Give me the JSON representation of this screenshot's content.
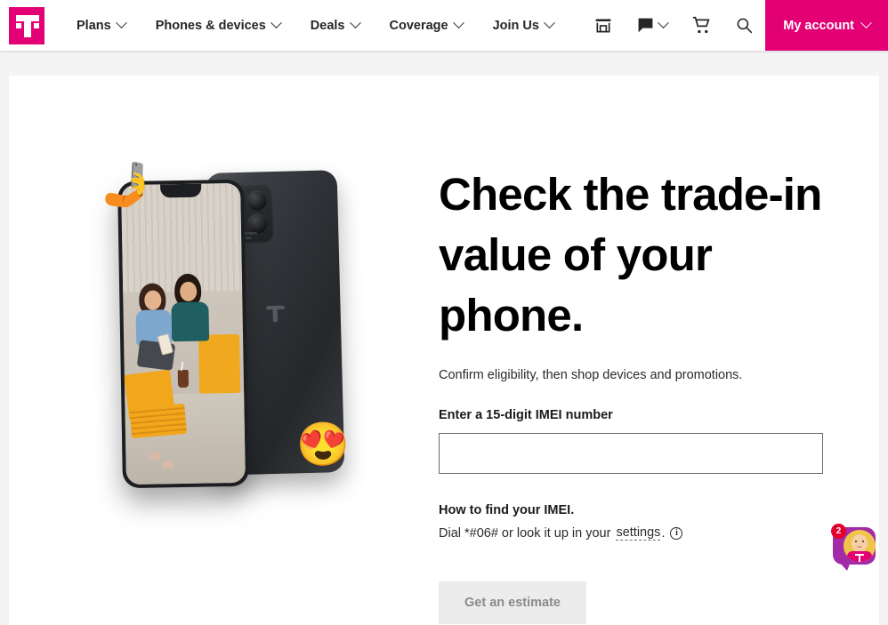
{
  "brand": {
    "name": "T-Mobile",
    "magenta": "#e20074",
    "logo_icon": "tmobile-logo"
  },
  "header": {
    "nav": [
      {
        "label": "Plans",
        "has_dropdown": true
      },
      {
        "label": "Phones & devices",
        "has_dropdown": true
      },
      {
        "label": "Deals",
        "has_dropdown": true
      },
      {
        "label": "Coverage",
        "has_dropdown": true
      },
      {
        "label": "Join Us",
        "has_dropdown": true
      }
    ],
    "icons": [
      {
        "name": "store-icon"
      },
      {
        "name": "chat-icon",
        "has_dropdown": true
      },
      {
        "name": "cart-icon"
      },
      {
        "name": "search-icon"
      }
    ],
    "account_button": {
      "label": "My account",
      "has_dropdown": true,
      "background": "#e20074",
      "text_color": "#ffffff"
    }
  },
  "hero": {
    "title": "Check the trade-in value of your phone.",
    "subtitle": "Confirm eligibility, then shop devices and promotions.",
    "image": {
      "alt": "Two phones, front screen showing a selfie of two women sitting in yellow chairs, back phone dark gray with quad camera",
      "emoji_selfie": "🤳",
      "emoji_heart_eyes": "😍"
    }
  },
  "form": {
    "imei_label": "Enter a 15-digit IMEI number",
    "imei_value": "",
    "imei_placeholder": "",
    "howto_title": "How to find your IMEI.",
    "howto_text_before": "Dial *#06# or look it up in your",
    "howto_link": "settings",
    "howto_text_after": ".",
    "info_icon_glyph": "i",
    "submit_label": "Get an estimate",
    "submit_disabled": true
  },
  "chat_widget": {
    "name": "chat-assistant",
    "badge_count": "2",
    "bubble_color": "#a32ba8",
    "badge_color": "#e4002b"
  }
}
